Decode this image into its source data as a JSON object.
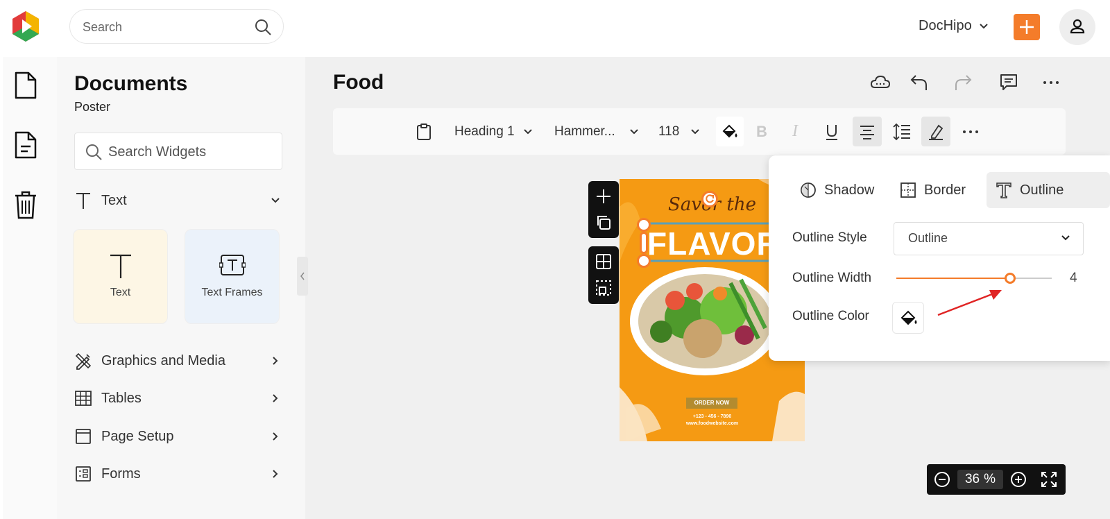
{
  "topbar": {
    "search_placeholder": "Search",
    "brand": "DocHipo"
  },
  "rail": {
    "items": [
      "file-icon",
      "document-list-icon",
      "trash-icon"
    ]
  },
  "panel": {
    "title": "Documents",
    "subtitle": "Poster",
    "search_placeholder": "Search Widgets",
    "text_section": "Text",
    "cards": [
      {
        "label": "Text",
        "bg": "#fdf6e5"
      },
      {
        "label": "Text Frames",
        "bg": "#ebf2fa"
      }
    ],
    "sections": [
      "Graphics and Media",
      "Tables",
      "Page Setup",
      "Forms"
    ]
  },
  "doc": {
    "title": "Food"
  },
  "toolbar": {
    "style": "Heading 1",
    "font": "Hammer...",
    "size": "118"
  },
  "poster": {
    "script_title": "Savor the",
    "headline": "FLAVOR",
    "cta": "ORDER NOW",
    "phone": "+123 - 456 - 7890",
    "website": "www.foodwebsite.com",
    "bg_color": "#f59a13"
  },
  "outline_panel": {
    "tabs": [
      "Shadow",
      "Border",
      "Outline"
    ],
    "active_tab": "Outline",
    "style_label": "Outline Style",
    "style_value": "Outline",
    "width_label": "Outline Width",
    "width_value": "4",
    "width_fraction": 0.73,
    "color_label": "Outline Color",
    "accent": "#f47c2a"
  },
  "zoom": {
    "value": "36",
    "unit": "%"
  }
}
